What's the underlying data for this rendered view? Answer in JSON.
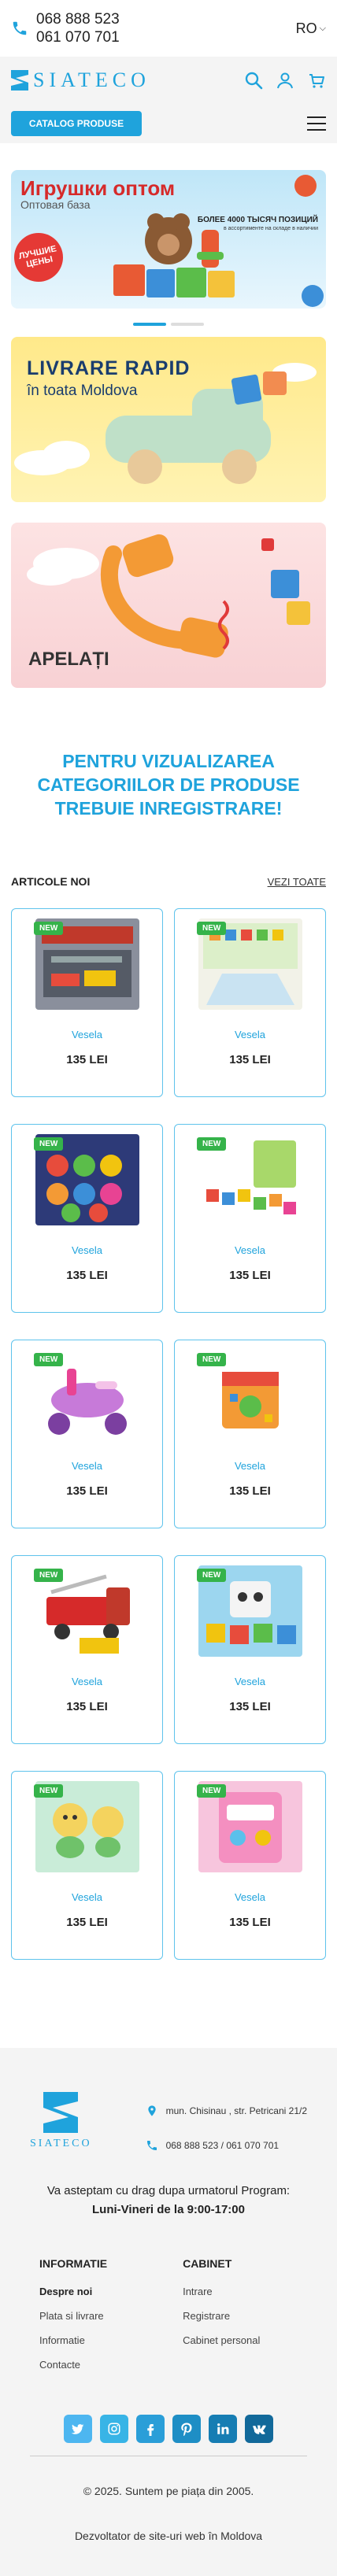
{
  "topbar": {
    "phone1": "068 888 523",
    "phone2": "061 070 701",
    "lang": "RO"
  },
  "header": {
    "logo_text": "SIATECO",
    "catalog_button": "CATALOG PRODUSE"
  },
  "banners": {
    "b1_title": "Игрушки оптом",
    "b1_subtitle": "Оптовая база",
    "b1_sticker": "ЛУЧШИЕ ЦЕНЫ",
    "b1_blurb": "БОЛЕЕ 4000 ТЫСЯЧ ПОЗИЦИЙ",
    "b1_blurb2": "в ассортименте на складе в наличии",
    "b2_title": "LIVRARE RAPID",
    "b2_subtitle": "în toata Moldova",
    "b3_title": "APELAȚI"
  },
  "registration_message": "PENTRU VIZUALIZAREA CATEGORIILOR DE PRODUSE TREBUIE INREGISTRARE!",
  "new_items": {
    "heading": "ARTICOLE NOI",
    "view_all": "VEZI TOATE",
    "badge": "NEW",
    "products": [
      {
        "brand": "Vesela",
        "price": "135 LEI",
        "img": "train-set"
      },
      {
        "brand": "Vesela",
        "price": "135 LEI",
        "img": "play-mat"
      },
      {
        "brand": "Vesela",
        "price": "135 LEI",
        "img": "balls-box"
      },
      {
        "brand": "Vesela",
        "price": "135 LEI",
        "img": "blocks-set"
      },
      {
        "brand": "Vesela",
        "price": "135 LEI",
        "img": "ride-on"
      },
      {
        "brand": "Vesela",
        "price": "135 LEI",
        "img": "activity-cube"
      },
      {
        "brand": "Vesela",
        "price": "135 LEI",
        "img": "fire-truck"
      },
      {
        "brand": "Vesela",
        "price": "135 LEI",
        "img": "robot-kit"
      },
      {
        "brand": "Vesela",
        "price": "135 LEI",
        "img": "plush-toy"
      },
      {
        "brand": "Vesela",
        "price": "135 LEI",
        "img": "pink-toy"
      }
    ]
  },
  "footer": {
    "logo_text": "SIATECO",
    "address": "mun. Chisinau , str. Petricani 21/2",
    "phones": "068 888 523 / 061 070 701",
    "hours_intro": "Va asteptam cu drag dupa urmatorul Program:",
    "hours": "Luni-Vineri de la 9:00-17:00",
    "info_heading": "INFORMATIE",
    "info_links": [
      "Despre noi",
      "Plata si livrare",
      "Informatie",
      "Contacte"
    ],
    "cabinet_heading": "CABINET",
    "cabinet_links": [
      "Intrare",
      "Registrare",
      "Cabinet personal"
    ],
    "socials": [
      "twitter",
      "instagram",
      "facebook",
      "pinterest",
      "linkedin",
      "vk"
    ],
    "copyright": "© 2025. Suntem pe piața din 2005.",
    "developer": "Dezvoltator de site-uri web în Moldova"
  },
  "colors": {
    "accent": "#1fa3dc",
    "new_badge": "#35b34a"
  }
}
